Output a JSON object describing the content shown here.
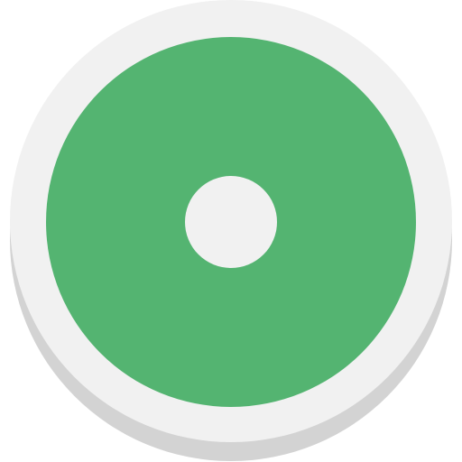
{
  "icon": {
    "name": "record-button-icon",
    "colors": {
      "shadow": "#d3d3d3",
      "rim": "#f1f1f1",
      "disc": "#54b471",
      "center": "#f1f1f1"
    }
  }
}
